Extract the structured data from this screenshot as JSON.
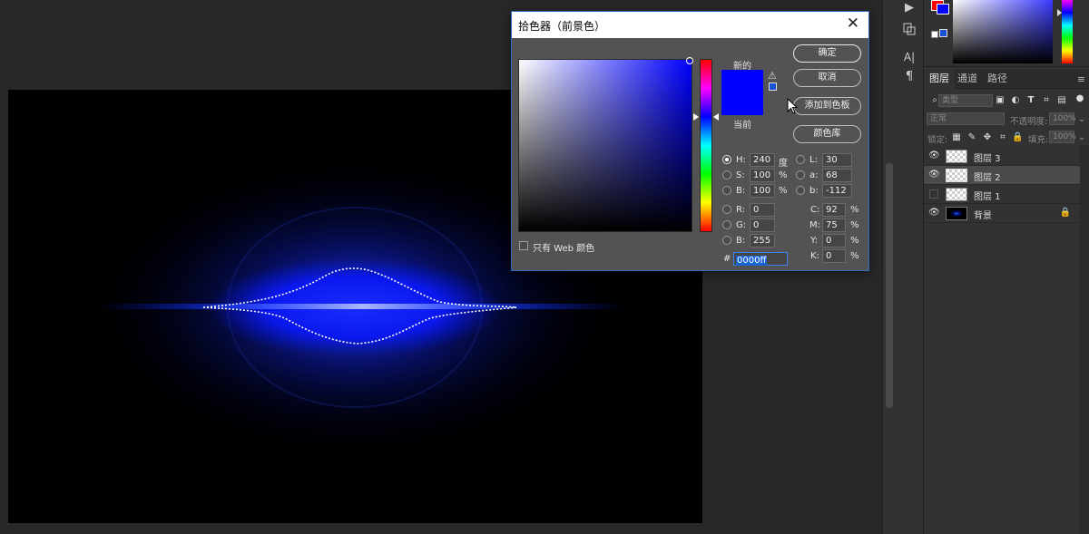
{
  "dialog": {
    "title": "拾色器（前景色）",
    "close_glyph": "✕",
    "new_label": "新的",
    "current_label": "当前",
    "new_color": "#0000ff",
    "buttons": {
      "ok": "确定",
      "cancel": "取消",
      "add_swatch": "添加到色板",
      "color_library": "颜色库"
    },
    "hsb": {
      "h_label": "H:",
      "h_value": "240",
      "h_unit": "度",
      "s_label": "S:",
      "s_value": "100",
      "s_unit": "%",
      "b_label": "B:",
      "b_value": "100",
      "b_unit": "%"
    },
    "lab": {
      "l_label": "L:",
      "l_value": "30",
      "a_label": "a:",
      "a_value": "68",
      "b_label": "b:",
      "b_value": "-112"
    },
    "rgb": {
      "r_label": "R:",
      "r_value": "0",
      "g_label": "G:",
      "g_value": "0",
      "b_label": "B:",
      "b_value": "255"
    },
    "cmyk": {
      "c_label": "C:",
      "c_value": "92",
      "c_unit": "%",
      "m_label": "M:",
      "m_value": "75",
      "m_unit": "%",
      "y_label": "Y:",
      "y_value": "0",
      "y_unit": "%",
      "k_label": "K:",
      "k_value": "0",
      "k_unit": "%"
    },
    "hex_label": "#",
    "hex_value": "0000ff",
    "web_only_label": "只有 Web 颜色"
  },
  "panel": {
    "foreground_color": "#ff0000",
    "background_color": "#0000ff",
    "tabs": [
      "图层",
      "通道",
      "路径"
    ],
    "menu_glyph": "≡",
    "filter_placeholder": "类型",
    "blend_mode": "正常",
    "opacity_label": "不透明度:",
    "opacity_value": "100%",
    "lock_label": "锁定:",
    "fill_label": "填充:",
    "fill_value": "100%",
    "layers": [
      {
        "name": "图层 3",
        "visible": true,
        "selected": false
      },
      {
        "name": "图层 2",
        "visible": true,
        "selected": true
      },
      {
        "name": "图层 1",
        "visible": false,
        "selected": false
      },
      {
        "name": "背景",
        "visible": true,
        "selected": false,
        "locked": true
      }
    ]
  },
  "tools": {
    "play_glyph": "▶",
    "type_glyph": "A|",
    "paragraph_glyph": "¶"
  }
}
